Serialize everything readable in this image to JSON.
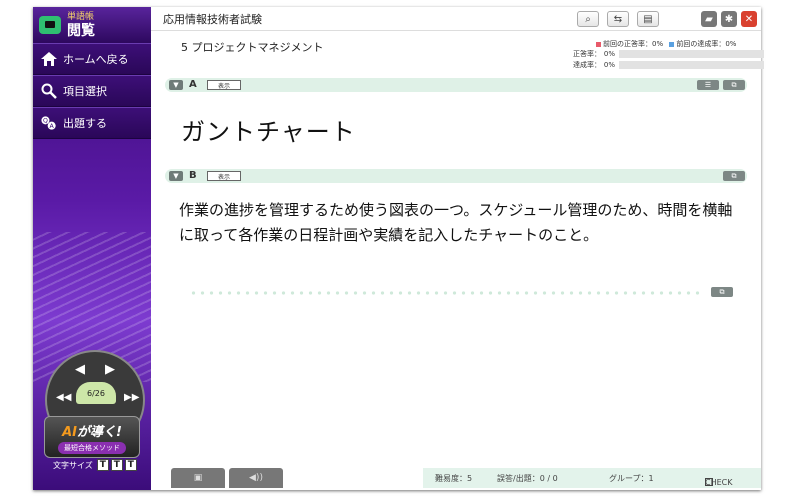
{
  "sidebar": {
    "subtitle": "単語帳",
    "title": "閲覧",
    "items": [
      {
        "label": "ホームへ戻る",
        "icon": "home-icon"
      },
      {
        "label": "項目選択",
        "icon": "search-icon"
      },
      {
        "label": "出題する",
        "icon": "qa-icon"
      }
    ],
    "pager": {
      "count": "6/26"
    },
    "ai_badge": {
      "ai": "AI",
      "main": "が導く!",
      "sub": "最短合格メソッド"
    },
    "font_size": {
      "label": "文字サイズ",
      "buttons": [
        "T",
        "T",
        "T"
      ]
    }
  },
  "header": {
    "title": "応用情報技術者試験",
    "icons": [
      "search-icon",
      "swap-icon",
      "print-icon",
      "folder-icon",
      "gear-icon",
      "close-icon"
    ]
  },
  "section": "5 プロジェクトマネジメント",
  "stats": {
    "legend_correct": "前回の正答率：",
    "legend_correct_val": "0%",
    "legend_achieve": "前回の達成率：",
    "legend_achieve_val": "0%",
    "correct_label": "正答率：",
    "correct_val": "0%",
    "achieve_label": "達成率：",
    "achieve_val": "0%",
    "correct_rate": 0,
    "achieve_rate": 0,
    "colors": {
      "correct": "#e85a6a",
      "achieve": "#5aa0e0"
    }
  },
  "panel_a": {
    "letter": "A",
    "show": "表示"
  },
  "term": "ガントチャート",
  "panel_b": {
    "letter": "B",
    "show": "表示"
  },
  "definition": "作業の進捗を管理するため使う図表の一つ。スケジュール管理のため、時間を横軸に取って各作業の日程計画や実績を記入したチャートのこと。",
  "footer": {
    "difficulty": "難易度：5",
    "wrong": "誤答/出題：0 / 0",
    "group": "グループ：1",
    "check": "CHECK"
  }
}
